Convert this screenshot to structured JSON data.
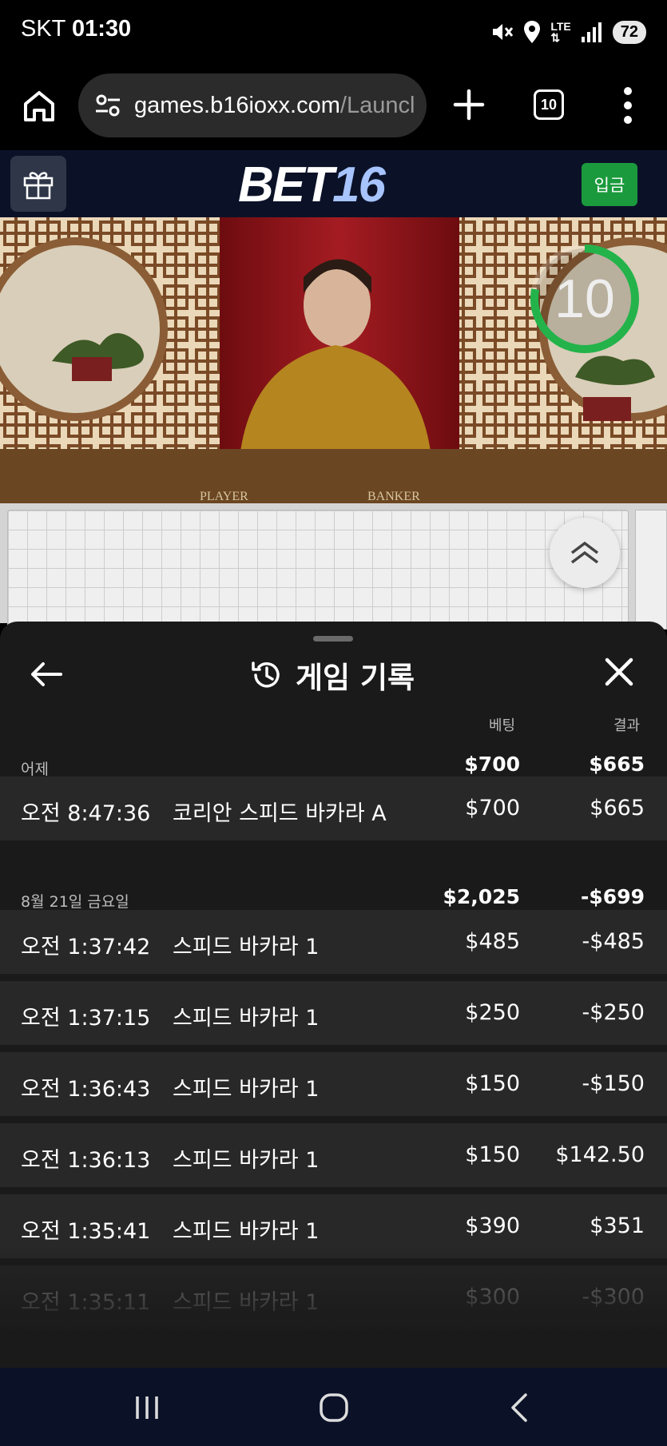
{
  "status_bar": {
    "carrier": "SKT",
    "time": "01:30",
    "network": "LTE",
    "battery": "72",
    "icons": [
      "mute-icon",
      "location-icon",
      "lte-icon",
      "signal-icon",
      "battery-icon"
    ]
  },
  "browser": {
    "url_domain": "games.b16ioxx.com",
    "url_path": "/Launcl",
    "tab_count": "10",
    "icons": [
      "home-icon",
      "site-settings-icon",
      "plus-icon",
      "more-icon"
    ]
  },
  "site_header": {
    "logo_part1": "BET",
    "logo_part2": "16",
    "deposit_label": "입금",
    "icons": [
      "gift-icon"
    ]
  },
  "video": {
    "countdown": "10",
    "countdown_fraction": 0.78,
    "colors": {
      "ring": "#23b34a"
    }
  },
  "sheet": {
    "title": "게임 기록",
    "col_bet": "베팅",
    "col_result": "결과",
    "icons": [
      "back-arrow-icon",
      "history-icon",
      "close-icon",
      "chevron-up-double-icon"
    ],
    "groups": [
      {
        "label": "어제",
        "bet_total": "$700",
        "result_total": "$665",
        "rows": [
          {
            "time": "오전 8:47:36",
            "game": "코리안 스피드 바카라 A",
            "bet": "$700",
            "result": "$665"
          }
        ]
      },
      {
        "label": "8월 21일 금요일",
        "bet_total": "$2,025",
        "result_total": "-$699",
        "rows": [
          {
            "time": "오전 1:37:42",
            "game": "스피드 바카라 1",
            "bet": "$485",
            "result": "-$485"
          },
          {
            "time": "오전 1:37:15",
            "game": "스피드 바카라 1",
            "bet": "$250",
            "result": "-$250"
          },
          {
            "time": "오전 1:36:43",
            "game": "스피드 바카라 1",
            "bet": "$150",
            "result": "-$150"
          },
          {
            "time": "오전 1:36:13",
            "game": "스피드 바카라 1",
            "bet": "$150",
            "result": "$142.50"
          },
          {
            "time": "오전 1:35:41",
            "game": "스피드 바카라 1",
            "bet": "$390",
            "result": "$351"
          },
          {
            "time": "오전 1:35:11",
            "game": "스피드 바카라 1",
            "bet": "$300",
            "result": "-$300"
          }
        ]
      }
    ]
  },
  "nav_bar": {
    "icons": [
      "recent-apps-icon",
      "home-nav-icon",
      "back-nav-icon"
    ]
  }
}
